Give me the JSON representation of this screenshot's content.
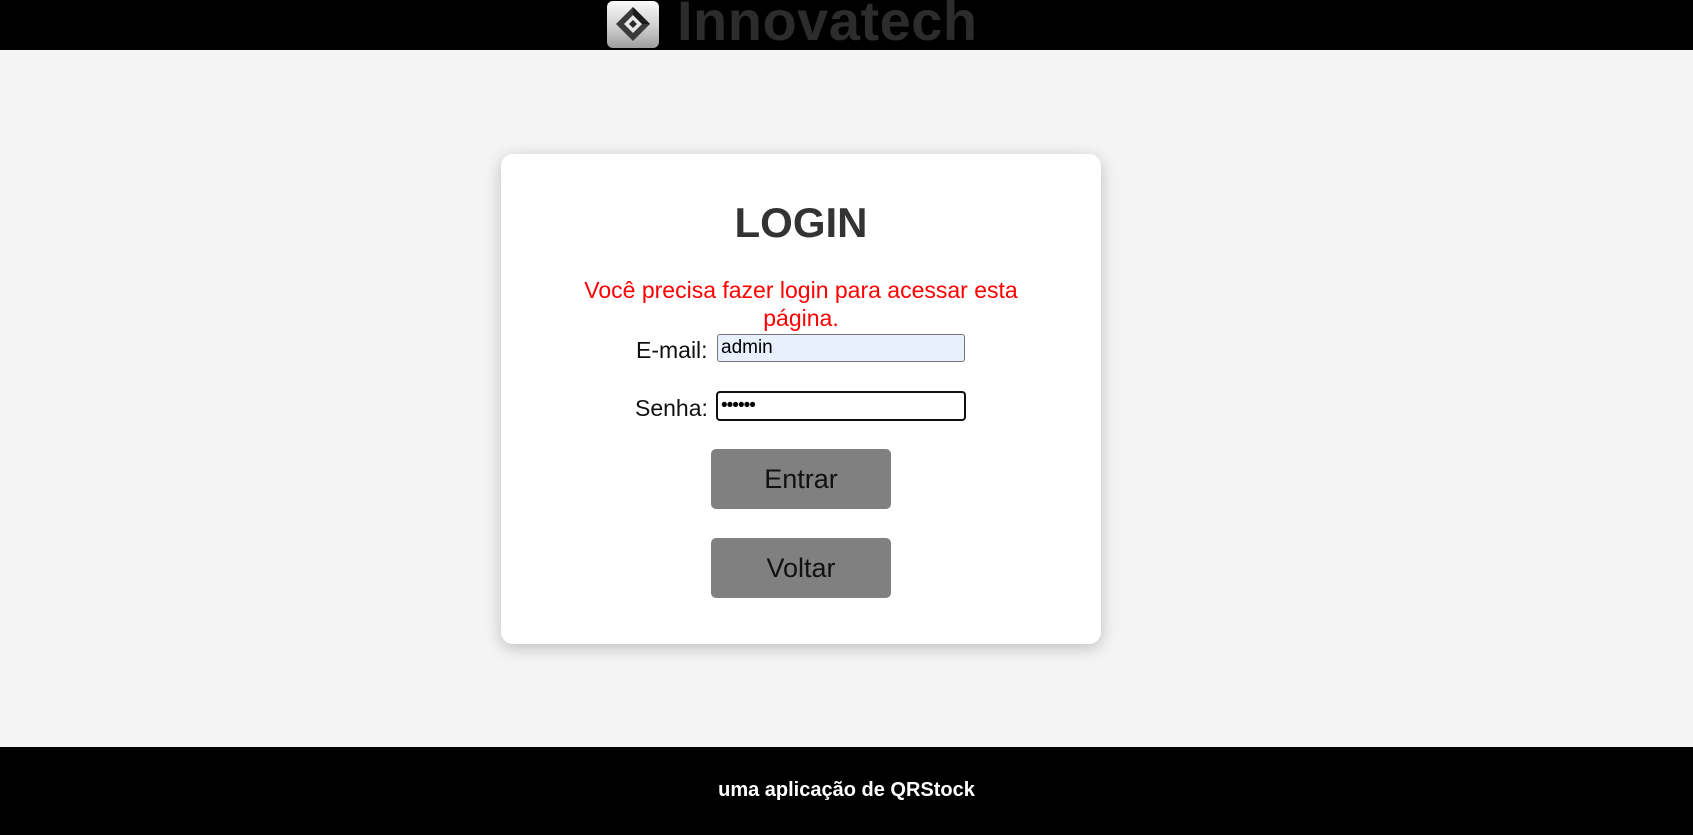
{
  "header": {
    "brand_name": "Innovatech",
    "logo_icon": "innovatech-logo-icon",
    "background": "#000000"
  },
  "login": {
    "title": "LOGIN",
    "error_message": "Você precisa fazer login para acessar esta página.",
    "error_color": "#ff0000",
    "email_label": "E-mail:",
    "email_value": "admin",
    "password_label": "Senha:",
    "password_value": "••••••",
    "submit_label": "Entrar",
    "back_label": "Voltar",
    "button_color": "#808080"
  },
  "footer": {
    "text": "uma aplicação de QRStock"
  }
}
